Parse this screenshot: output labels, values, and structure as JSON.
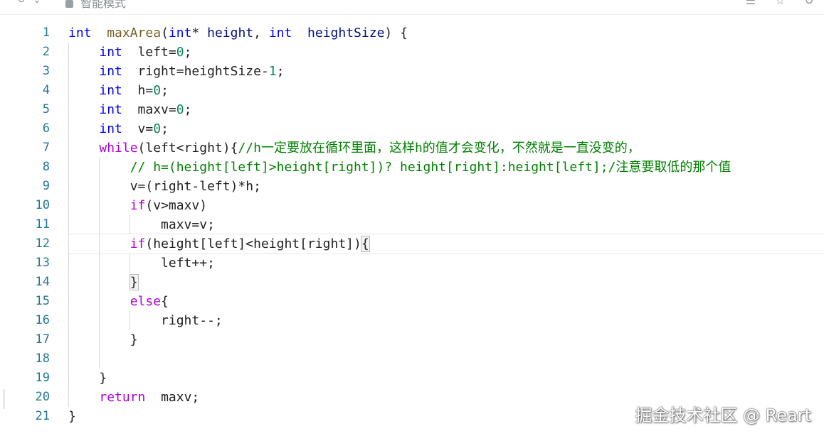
{
  "topbar": {
    "mode_label": "智能模式",
    "left_icons": [
      "↻",
      "⌄"
    ],
    "right_icons": [
      "☰",
      "☆",
      "↺"
    ]
  },
  "editor": {
    "current_line": 12,
    "lines": [
      {
        "n": "1",
        "tokens": [
          [
            "kw",
            "int"
          ],
          [
            "",
            "  "
          ],
          [
            "fn",
            "maxArea"
          ],
          [
            "",
            "("
          ],
          [
            "kw",
            "int"
          ],
          [
            "",
            "* "
          ],
          [
            "prm",
            "height"
          ],
          [
            "",
            ", "
          ],
          [
            "kw",
            "int"
          ],
          [
            "",
            "  "
          ],
          [
            "prm",
            "heightSize"
          ],
          [
            "",
            ") {"
          ]
        ]
      },
      {
        "n": "2",
        "tokens": [
          [
            "",
            "    "
          ],
          [
            "kw",
            "int"
          ],
          [
            "",
            "  left="
          ],
          [
            "num",
            "0"
          ],
          [
            "",
            ";"
          ]
        ]
      },
      {
        "n": "3",
        "tokens": [
          [
            "",
            "    "
          ],
          [
            "kw",
            "int"
          ],
          [
            "",
            "  right=heightSize-"
          ],
          [
            "num",
            "1"
          ],
          [
            "",
            ";"
          ]
        ]
      },
      {
        "n": "4",
        "tokens": [
          [
            "",
            "    "
          ],
          [
            "kw",
            "int"
          ],
          [
            "",
            "  h="
          ],
          [
            "num",
            "0"
          ],
          [
            "",
            ";"
          ]
        ]
      },
      {
        "n": "5",
        "tokens": [
          [
            "",
            "    "
          ],
          [
            "kw",
            "int"
          ],
          [
            "",
            "  maxv="
          ],
          [
            "num",
            "0"
          ],
          [
            "",
            ";"
          ]
        ]
      },
      {
        "n": "6",
        "tokens": [
          [
            "",
            "    "
          ],
          [
            "kw",
            "int"
          ],
          [
            "",
            "  v="
          ],
          [
            "num",
            "0"
          ],
          [
            "",
            ";"
          ]
        ]
      },
      {
        "n": "7",
        "tokens": [
          [
            "",
            "    "
          ],
          [
            "ctl",
            "while"
          ],
          [
            "",
            "(left<right){"
          ],
          [
            "cmt",
            "//h一定要放在循环里面，这样h的值才会变化，不然就是一直没变的，"
          ]
        ]
      },
      {
        "n": "8",
        "tokens": [
          [
            "",
            "        "
          ],
          [
            "cmt",
            "// h=(height[left]>height[right])? height[right]:height[left];/注意要取低的那个值"
          ]
        ]
      },
      {
        "n": "9",
        "tokens": [
          [
            "",
            "        v=(right-left)*h;"
          ]
        ]
      },
      {
        "n": "10",
        "tokens": [
          [
            "",
            "        "
          ],
          [
            "ctl",
            "if"
          ],
          [
            "",
            "(v>maxv)"
          ]
        ]
      },
      {
        "n": "11",
        "tokens": [
          [
            "",
            "            maxv=v;"
          ]
        ]
      },
      {
        "n": "12",
        "tokens": [
          [
            "",
            "        "
          ],
          [
            "ctl",
            "if"
          ],
          [
            "",
            "(height[left]<height[right])"
          ],
          [
            "bracket-match",
            "{"
          ]
        ]
      },
      {
        "n": "13",
        "tokens": [
          [
            "",
            "            left++;"
          ]
        ]
      },
      {
        "n": "14",
        "tokens": [
          [
            "",
            "        "
          ],
          [
            "bracket-match",
            "}"
          ]
        ]
      },
      {
        "n": "15",
        "tokens": [
          [
            "",
            "        "
          ],
          [
            "ctl",
            "else"
          ],
          [
            "",
            "{"
          ]
        ]
      },
      {
        "n": "16",
        "tokens": [
          [
            "",
            "            right--;"
          ]
        ]
      },
      {
        "n": "17",
        "tokens": [
          [
            "",
            "        }"
          ]
        ]
      },
      {
        "n": "18",
        "tokens": []
      },
      {
        "n": "19",
        "tokens": [
          [
            "",
            "    }"
          ]
        ]
      },
      {
        "n": "20",
        "tokens": [
          [
            "",
            "    "
          ],
          [
            "ctl",
            "return"
          ],
          [
            "",
            "  maxv;"
          ]
        ]
      },
      {
        "n": "21",
        "tokens": [
          [
            "",
            "}"
          ]
        ]
      }
    ]
  },
  "watermark": "掘金技术社区 @ Reart"
}
